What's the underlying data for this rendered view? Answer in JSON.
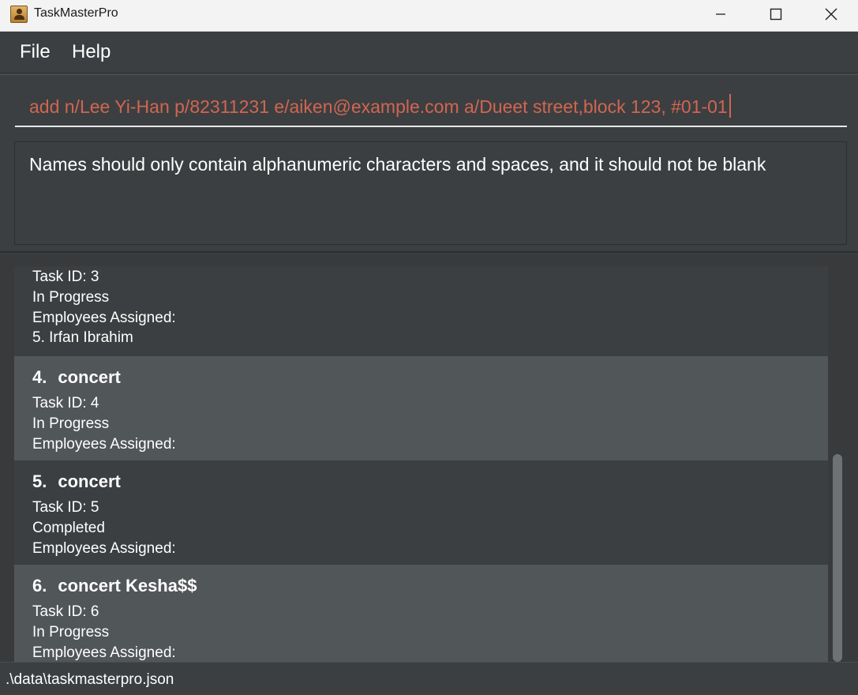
{
  "window": {
    "title": "TaskMasterPro"
  },
  "menu": {
    "file": "File",
    "help": "Help"
  },
  "command": {
    "value": "add n/Lee Yi-Han p/82311231 e/aiken@example.com a/Dueet street,block 123, #01-01",
    "error_color": "#d06651"
  },
  "result": {
    "message": "Names should only contain alphanumeric characters and spaces, and it should not be blank"
  },
  "tasks": [
    {
      "index": "",
      "title": "",
      "task_id": "Task ID: 3",
      "status": "In Progress",
      "employees_label": "Employees Assigned:",
      "employees": [
        "5. Irfan Ibrahim"
      ]
    },
    {
      "index": "4.",
      "title": "concert",
      "task_id": "Task ID: 4",
      "status": "In Progress",
      "employees_label": "Employees Assigned:",
      "employees": []
    },
    {
      "index": "5.",
      "title": "concert",
      "task_id": "Task ID: 5",
      "status": "Completed",
      "employees_label": "Employees Assigned:",
      "employees": []
    },
    {
      "index": "6.",
      "title": "concert Kesha$$",
      "task_id": "Task ID: 6",
      "status": "In Progress",
      "employees_label": "Employees Assigned:",
      "employees": []
    }
  ],
  "status_bar": {
    "path": ".\\data\\taskmasterpro.json"
  },
  "icons": {
    "app": "app-icon",
    "minimize": "minimize-icon",
    "maximize": "maximize-icon",
    "close": "close-icon"
  }
}
